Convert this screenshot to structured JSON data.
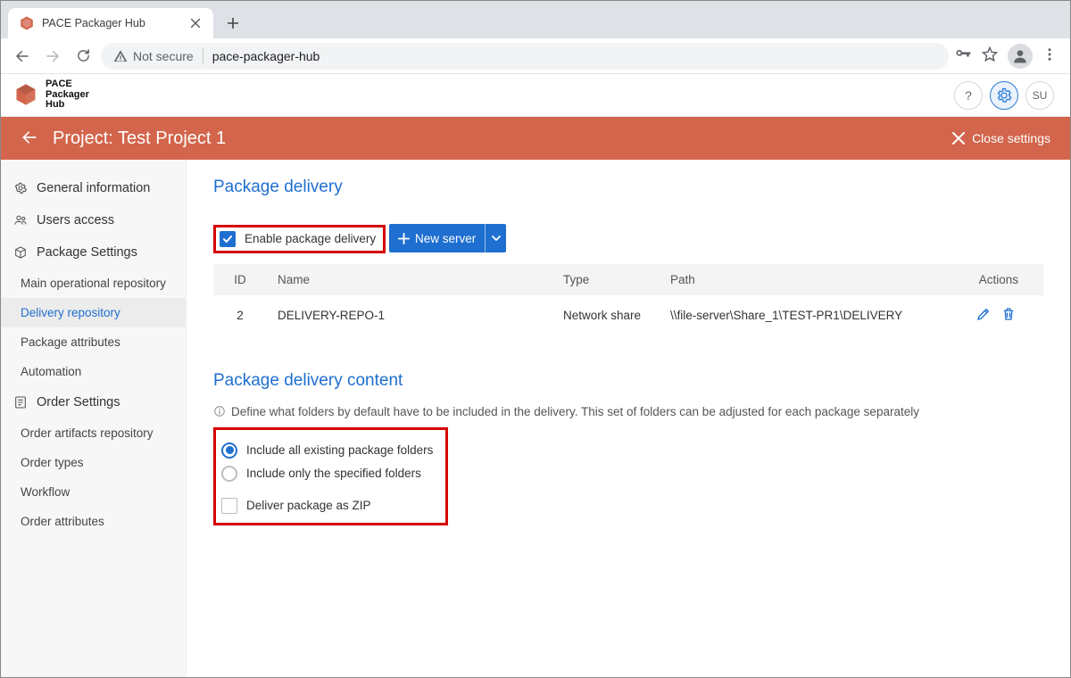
{
  "browser": {
    "tab_title": "PACE Packager Hub",
    "not_secure": "Not secure",
    "url": "pace-packager-hub"
  },
  "app": {
    "brand_line1": "PACE",
    "brand_line2": "Packager",
    "brand_line3": "Hub",
    "avatar_initials": "SU"
  },
  "banner": {
    "title": "Project: Test Project 1",
    "close": "Close settings"
  },
  "sidebar": {
    "groups": [
      {
        "icon": "gear",
        "label": "General information"
      },
      {
        "icon": "users",
        "label": "Users access"
      },
      {
        "icon": "box",
        "label": "Package Settings",
        "items": [
          "Main operational repository",
          "Delivery repository",
          "Package attributes",
          "Automation"
        ],
        "active_index": 1
      },
      {
        "icon": "list",
        "label": "Order Settings",
        "items": [
          "Order artifacts repository",
          "Order types",
          "Workflow",
          "Order attributes"
        ]
      }
    ]
  },
  "content": {
    "pkg_delivery_title": "Package delivery",
    "enable_label": "Enable package delivery",
    "new_server_label": "New server",
    "table": {
      "cols": [
        "ID",
        "Name",
        "Type",
        "Path",
        "Actions"
      ],
      "rows": [
        {
          "id": "2",
          "name": "DELIVERY-REPO-1",
          "type": "Network share",
          "path": "\\\\file-server\\Share_1\\TEST-PR1\\DELIVERY"
        }
      ]
    },
    "content_title": "Package delivery content",
    "content_hint": "Define what folders by default have to be included in the delivery. This set of folders can be adjusted for each package separately",
    "radio_all": "Include all existing package folders",
    "radio_spec": "Include only the specified folders",
    "zip_label": "Deliver package as ZIP"
  }
}
